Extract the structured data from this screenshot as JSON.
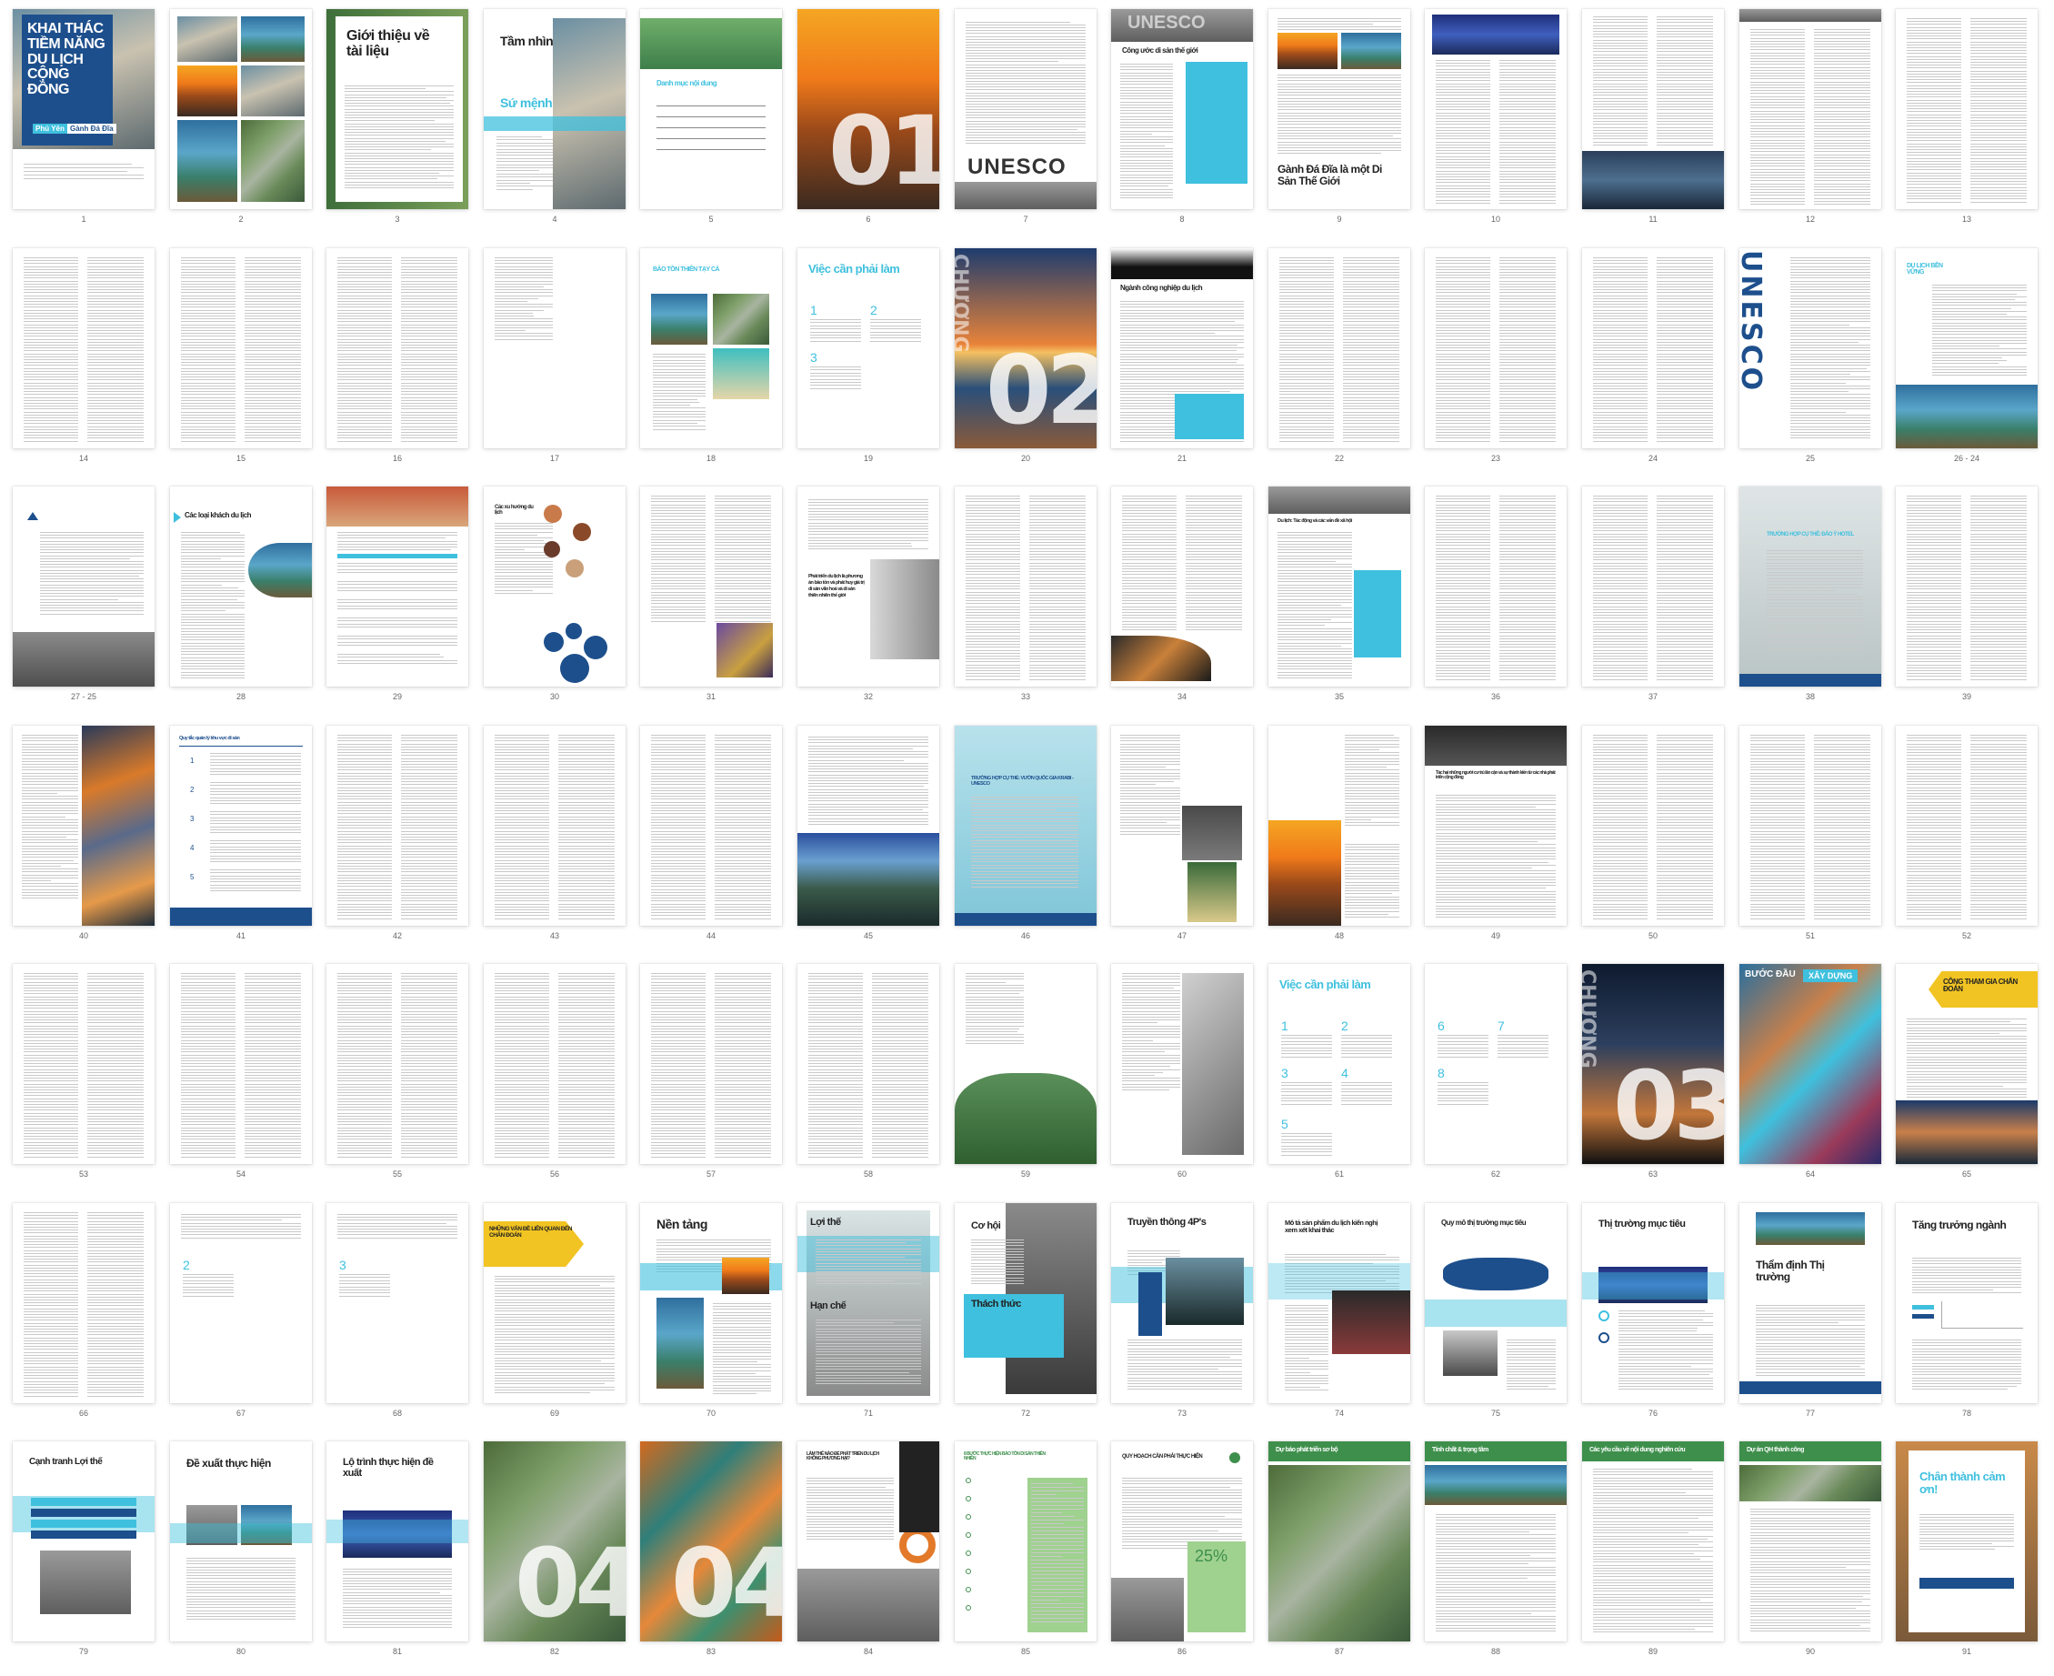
{
  "colors": {
    "accent": "#3fc0de",
    "navy": "#1d4f8c",
    "green": "#3e8f4c",
    "orange": "#e27a2a",
    "yellow": "#f2c423"
  },
  "pages": [
    {
      "n": "1",
      "kind": "cover",
      "title": "KHAI THÁC TIỀM NĂNG DU LỊCH CỘNG ĐỒNG",
      "tags": [
        "Phú Yên",
        "Gành Đá Đĩa"
      ]
    },
    {
      "n": "2",
      "kind": "collage"
    },
    {
      "n": "3",
      "kind": "title",
      "title": "Giới thiệu về tài liệu"
    },
    {
      "n": "4",
      "kind": "split",
      "title": "Tầm nhìn",
      "title2": "Sứ mệnh"
    },
    {
      "n": "5",
      "kind": "toc",
      "title": "Danh mục nội dung"
    },
    {
      "n": "6",
      "kind": "chapter",
      "bignum": "01",
      "theme": "sunset"
    },
    {
      "n": "7",
      "kind": "unesco",
      "title": "UNESCO"
    },
    {
      "n": "8",
      "kind": "cyanbox",
      "title": "UNESCO",
      "subtitle": "Công ước di sản thế giới"
    },
    {
      "n": "9",
      "kind": "titlebot",
      "title": "Gành Đá Đĩa là một Di Sản Thế Giới"
    },
    {
      "n": "10",
      "kind": "imgtop",
      "theme": "blue"
    },
    {
      "n": "11",
      "kind": "imgbot",
      "theme": "hall"
    },
    {
      "n": "12",
      "kind": "textimgtop"
    },
    {
      "n": "13",
      "kind": "text"
    },
    {
      "n": "14",
      "kind": "text"
    },
    {
      "n": "15",
      "kind": "text"
    },
    {
      "n": "16",
      "kind": "text"
    },
    {
      "n": "17",
      "kind": "textshort"
    },
    {
      "n": "18",
      "kind": "grid4",
      "title": "BẢO TỒN THIÊN TẠY CẢ"
    },
    {
      "n": "19",
      "kind": "numlist",
      "title": "Việc cần phải làm",
      "nums": [
        "1",
        "2",
        "3"
      ]
    },
    {
      "n": "20",
      "kind": "chapter",
      "bignum": "02",
      "theme": "sea",
      "vertical": "CHƯƠNG"
    },
    {
      "n": "21",
      "kind": "silhouette",
      "title": "Ngành công nghiệp du lịch"
    },
    {
      "n": "22",
      "kind": "text"
    },
    {
      "n": "23",
      "kind": "text"
    },
    {
      "n": "24",
      "kind": "text"
    },
    {
      "n": "25",
      "kind": "vertical",
      "title": "UNESCO"
    },
    {
      "n": "26 - 24",
      "kind": "imgbot2",
      "title": "DU LỊCH BỀN VỮNG"
    },
    {
      "n": "27 - 25",
      "kind": "imgbot3"
    },
    {
      "n": "28",
      "kind": "leaf",
      "title": "Các loại khách du lịch"
    },
    {
      "n": "29",
      "kind": "tablepage"
    },
    {
      "n": "30",
      "kind": "circles",
      "title": "Các xu hướng du lịch"
    },
    {
      "n": "31",
      "kind": "imgbr"
    },
    {
      "n": "32",
      "kind": "statue",
      "title": "Phát triển du lịch là phương án bảo tồn và phát huy giá trị di sản văn hoá và di sản thiên nhiên thế giới"
    },
    {
      "n": "33",
      "kind": "text"
    },
    {
      "n": "34",
      "kind": "hat"
    },
    {
      "n": "35",
      "kind": "cyanside",
      "title": "Du lịch: Tác động và các vấn đề xã hội"
    },
    {
      "n": "36",
      "kind": "text"
    },
    {
      "n": "37",
      "kind": "text"
    },
    {
      "n": "38",
      "kind": "fog",
      "title": "TRƯỜNG HỢP CỤ THỂ: ĐẢO Ý HOTEL"
    },
    {
      "n": "39",
      "kind": "text"
    },
    {
      "n": "40",
      "kind": "art"
    },
    {
      "n": "41",
      "kind": "navylist",
      "title": "Quy tắc quản lý khu vực di sản",
      "nums": [
        "1",
        "2",
        "3",
        "4",
        "5"
      ]
    },
    {
      "n": "42",
      "kind": "text"
    },
    {
      "n": "43",
      "kind": "text"
    },
    {
      "n": "44",
      "kind": "text"
    },
    {
      "n": "45",
      "kind": "coast"
    },
    {
      "n": "46",
      "kind": "cyanfull",
      "title": "TRƯỜNG HỢP CỤ THỂ: VƯỜN QUỐC GIA KRABI - UNESCO"
    },
    {
      "n": "47",
      "kind": "sign"
    },
    {
      "n": "48",
      "kind": "sunsetleft"
    },
    {
      "n": "49",
      "kind": "darktop",
      "title": "Tác hại những người cư trú lân cận và sự thành kiến từ các nhà phát triển cộng đồng"
    },
    {
      "n": "50",
      "kind": "text"
    },
    {
      "n": "51",
      "kind": "text"
    },
    {
      "n": "52",
      "kind": "text"
    },
    {
      "n": "53",
      "kind": "text"
    },
    {
      "n": "54",
      "kind": "text"
    },
    {
      "n": "55",
      "kind": "text"
    },
    {
      "n": "56",
      "kind": "text"
    },
    {
      "n": "57",
      "kind": "text"
    },
    {
      "n": "58",
      "kind": "text"
    },
    {
      "n": "59",
      "kind": "hills"
    },
    {
      "n": "60",
      "kind": "hands"
    },
    {
      "n": "61",
      "kind": "numlist",
      "title": "Việc cần phải làm",
      "nums": [
        "1",
        "2",
        "3",
        "4",
        "5"
      ]
    },
    {
      "n": "62",
      "kind": "numlist2",
      "nums": [
        "6",
        "7",
        "8"
      ]
    },
    {
      "n": "63",
      "kind": "chapter",
      "bignum": "03",
      "theme": "lighthouse",
      "vertical": "CHƯƠNG"
    },
    {
      "n": "64",
      "kind": "buoc",
      "title": "BƯỚC ĐẦU",
      "title2": "XÂY DỰNG"
    },
    {
      "n": "65",
      "kind": "yellowtag",
      "title": "CÔNG THAM GIA CHẨN ĐOÁN"
    },
    {
      "n": "66",
      "kind": "text"
    },
    {
      "n": "67",
      "kind": "numlist3",
      "nums": [
        "2"
      ]
    },
    {
      "n": "68",
      "kind": "numlist3",
      "nums": [
        "3"
      ]
    },
    {
      "n": "69",
      "kind": "arrowpage",
      "title": "NHỮNG VẤN ĐỀ LIÊN QUAN ĐẾN CHẨN ĐOÁN"
    },
    {
      "n": "70",
      "kind": "band",
      "title": "Nền tảng"
    },
    {
      "n": "71",
      "kind": "twohead",
      "title": "Lợi thế",
      "title2": "Hạn chế"
    },
    {
      "n": "72",
      "kind": "twohead2",
      "title": "Cơ hội",
      "title2": "Thách thức"
    },
    {
      "n": "73",
      "kind": "band2",
      "title": "Truyền thông 4P's"
    },
    {
      "n": "74",
      "kind": "crowd",
      "title": "Mô tả sản phẩm du lịch kiến nghị xem xét khai thác"
    },
    {
      "n": "75",
      "kind": "map",
      "title": "Quy mô thị trường mục tiêu"
    },
    {
      "n": "76",
      "kind": "market",
      "title": "Thị trường mục tiêu"
    },
    {
      "n": "77",
      "kind": "tham",
      "title": "Thẩm định Thị trường"
    },
    {
      "n": "78",
      "kind": "growth",
      "title": "Tăng trưởng ngành"
    },
    {
      "n": "79",
      "kind": "table2",
      "title": "Cạnh tranh Lợi thế"
    },
    {
      "n": "80",
      "kind": "propose",
      "title": "Đề xuất thực hiện"
    },
    {
      "n": "81",
      "kind": "roadmap",
      "title": "Lộ trình thực hiện đề xuất"
    },
    {
      "n": "82",
      "kind": "chapter",
      "bignum": "04",
      "theme": "aerial"
    },
    {
      "n": "83",
      "kind": "chapter",
      "bignum": "04",
      "theme": "autumn"
    },
    {
      "n": "84",
      "kind": "ring",
      "title": "LÀM THẾ NÀO ĐỂ PHÁT TRIỂN DU LỊCH KHÔNG PHƯƠNG HẠI?"
    },
    {
      "n": "85",
      "kind": "greenlist",
      "title": "8 BƯỚC THỰC HIỆN BẢO TỒN DI SẢN THIÊN NHIÊN"
    },
    {
      "n": "86",
      "kind": "pct",
      "title": "QUY HOẠCH CẦN PHẢI THỰC HIỆN",
      "pct": "25%"
    },
    {
      "n": "87",
      "kind": "greenhead",
      "title": "Dự báo phát triển sơ bộ"
    },
    {
      "n": "88",
      "kind": "greenhead2",
      "title": "Tính chất & trọng tâm"
    },
    {
      "n": "89",
      "kind": "greenhead3",
      "title": "Các yêu cầu về nội dung nghiên cứu"
    },
    {
      "n": "90",
      "kind": "greenhead4",
      "title": "Dự án QH thành công"
    },
    {
      "n": "91",
      "kind": "thanks",
      "title": "Chân thành cảm ơn!"
    }
  ]
}
